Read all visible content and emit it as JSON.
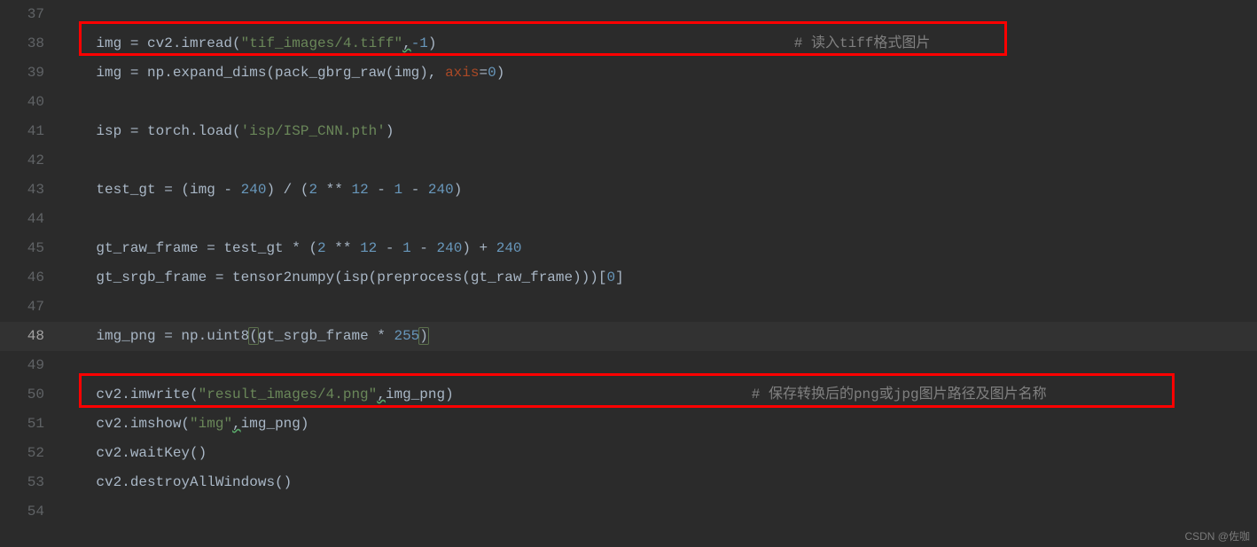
{
  "watermark": "CSDN @佐咖",
  "lines": [
    {
      "n": "37",
      "tokens": []
    },
    {
      "n": "38",
      "tokens": [
        {
          "t": "img = cv2.imread(",
          "c": "s-default"
        },
        {
          "t": "\"tif_images/4.tiff\"",
          "c": "s-string"
        },
        {
          "t": ",",
          "c": "s-default typo"
        },
        {
          "t": "-1",
          "c": "s-number"
        },
        {
          "t": ")                                          ",
          "c": "s-default"
        },
        {
          "t": "# 读入tiff格式图片",
          "c": "s-comment"
        }
      ]
    },
    {
      "n": "39",
      "tokens": [
        {
          "t": "img = np.expand_dims(pack_gbrg_raw(img), ",
          "c": "s-default"
        },
        {
          "t": "axis",
          "c": "s-kw"
        },
        {
          "t": "=",
          "c": "s-default"
        },
        {
          "t": "0",
          "c": "s-number"
        },
        {
          "t": ")",
          "c": "s-default"
        }
      ]
    },
    {
      "n": "40",
      "tokens": []
    },
    {
      "n": "41",
      "tokens": [
        {
          "t": "isp = torch.load(",
          "c": "s-default"
        },
        {
          "t": "'isp/ISP_CNN.pth'",
          "c": "s-string"
        },
        {
          "t": ")",
          "c": "s-default"
        }
      ]
    },
    {
      "n": "42",
      "tokens": []
    },
    {
      "n": "43",
      "tokens": [
        {
          "t": "test_gt = (img - ",
          "c": "s-default"
        },
        {
          "t": "240",
          "c": "s-number"
        },
        {
          "t": ") / (",
          "c": "s-default"
        },
        {
          "t": "2",
          "c": "s-number"
        },
        {
          "t": " ** ",
          "c": "s-default"
        },
        {
          "t": "12",
          "c": "s-number"
        },
        {
          "t": " - ",
          "c": "s-default"
        },
        {
          "t": "1",
          "c": "s-number"
        },
        {
          "t": " - ",
          "c": "s-default"
        },
        {
          "t": "240",
          "c": "s-number"
        },
        {
          "t": ")",
          "c": "s-default"
        }
      ]
    },
    {
      "n": "44",
      "tokens": []
    },
    {
      "n": "45",
      "tokens": [
        {
          "t": "gt_raw_frame = test_gt * (",
          "c": "s-default"
        },
        {
          "t": "2",
          "c": "s-number"
        },
        {
          "t": " ** ",
          "c": "s-default"
        },
        {
          "t": "12",
          "c": "s-number"
        },
        {
          "t": " - ",
          "c": "s-default"
        },
        {
          "t": "1",
          "c": "s-number"
        },
        {
          "t": " - ",
          "c": "s-default"
        },
        {
          "t": "240",
          "c": "s-number"
        },
        {
          "t": ") + ",
          "c": "s-default"
        },
        {
          "t": "240",
          "c": "s-number"
        }
      ]
    },
    {
      "n": "46",
      "tokens": [
        {
          "t": "gt_srgb_frame = tensor2numpy(isp(preprocess(gt_raw_frame)))[",
          "c": "s-default"
        },
        {
          "t": "0",
          "c": "s-number"
        },
        {
          "t": "]",
          "c": "s-default"
        }
      ]
    },
    {
      "n": "47",
      "tokens": []
    },
    {
      "n": "48",
      "current": true,
      "tokens": [
        {
          "t": "img_png = np.uint8",
          "c": "s-default"
        },
        {
          "t": "(",
          "c": "s-default bracket-match"
        },
        {
          "t": "gt_srgb_frame * ",
          "c": "s-default"
        },
        {
          "t": "255",
          "c": "s-number"
        },
        {
          "t": ")",
          "c": "s-default bracket-match"
        }
      ]
    },
    {
      "n": "49",
      "tokens": []
    },
    {
      "n": "50",
      "tokens": [
        {
          "t": "cv2.imwrite(",
          "c": "s-default"
        },
        {
          "t": "\"result_images/4.png\"",
          "c": "s-string"
        },
        {
          "t": ",",
          "c": "s-default typo"
        },
        {
          "t": "img_png)                                   ",
          "c": "s-default"
        },
        {
          "t": "# 保存转换后的png或jpg图片路径及图片名称",
          "c": "s-comment"
        }
      ]
    },
    {
      "n": "51",
      "tokens": [
        {
          "t": "cv2.imshow(",
          "c": "s-default"
        },
        {
          "t": "\"img\"",
          "c": "s-string"
        },
        {
          "t": ",",
          "c": "s-default typo"
        },
        {
          "t": "img_png)",
          "c": "s-default"
        }
      ]
    },
    {
      "n": "52",
      "tokens": [
        {
          "t": "cv2.waitKey()",
          "c": "s-default"
        }
      ]
    },
    {
      "n": "53",
      "tokens": [
        {
          "t": "cv2.destroyAllWindows()",
          "c": "s-default"
        }
      ]
    },
    {
      "n": "54",
      "tokens": []
    }
  ]
}
